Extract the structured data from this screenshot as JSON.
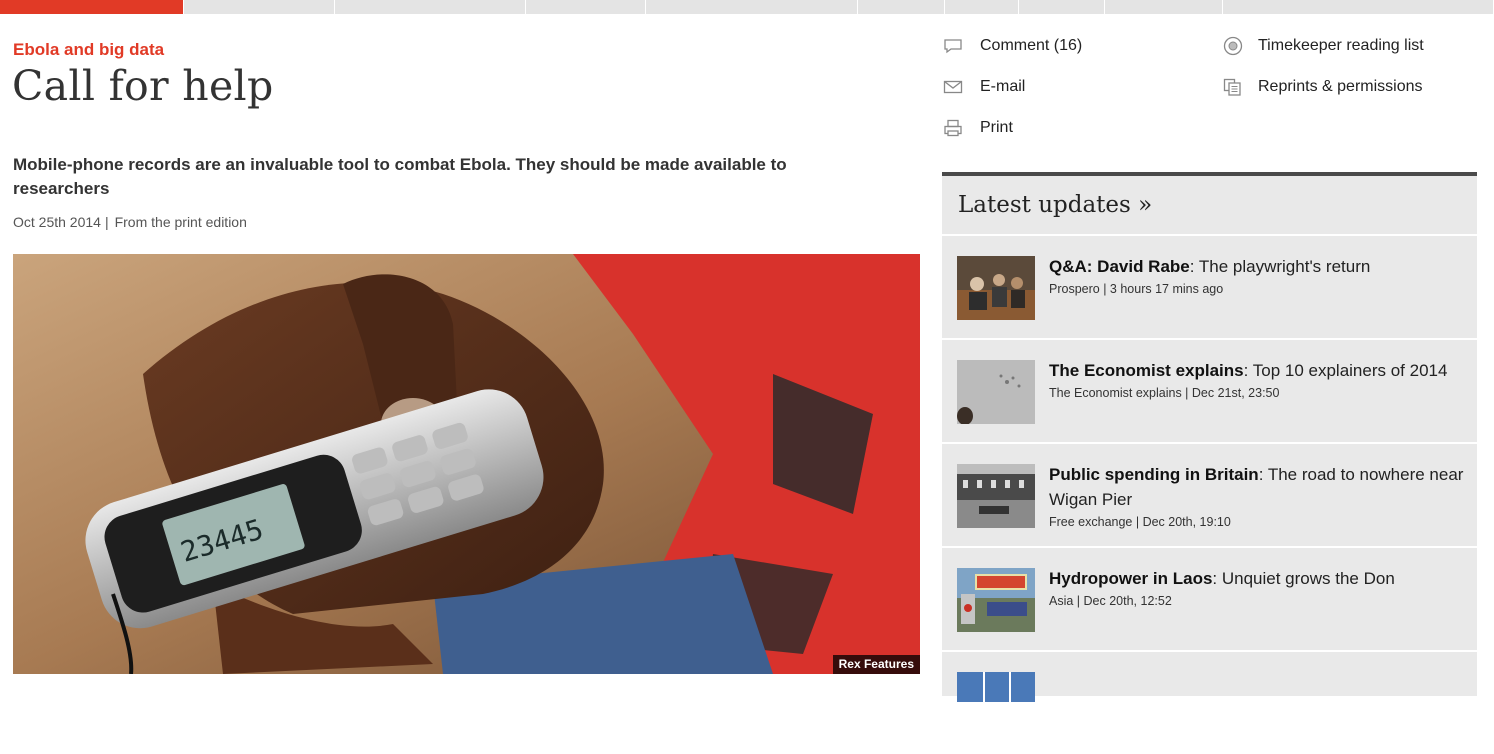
{
  "article": {
    "flytitle": "Ebola and big data",
    "headline": "Call for help",
    "rubric": "Mobile-phone records are an invaluable tool to combat Ebola. They should be made available to researchers",
    "date": "Oct 25th 2014",
    "separator": "|",
    "edition": "From the print edition",
    "image_credit": "Rex Features",
    "image_icon": "mobile-phone-in-hand-photo"
  },
  "share_tools": {
    "comment": "Comment (16)",
    "email": "E-mail",
    "print": "Print",
    "reading_list": "Timekeeper reading list",
    "reprints": "Reprints & permissions"
  },
  "latest": {
    "heading": "Latest updates »",
    "items": [
      {
        "title_bold": "Q&A: David Rabe",
        "title_rest": ": The playwright's return",
        "meta": "Prospero | 3 hours 17 mins ago"
      },
      {
        "title_bold": "The Economist explains",
        "title_rest": ": Top 10 explainers of 2014",
        "meta": "The Economist explains | Dec 21st, 23:50"
      },
      {
        "title_bold": "Public spending in Britain",
        "title_rest": ": The road to nowhere near Wigan Pier",
        "meta": "Free exchange | Dec 20th, 19:10"
      },
      {
        "title_bold": "Hydropower in Laos",
        "title_rest": ": Unquiet grows the Don",
        "meta": "Asia | Dec 20th, 12:52"
      }
    ]
  },
  "colors": {
    "accent_red": "#e13a26",
    "panel_grey": "#e9e9e9"
  }
}
